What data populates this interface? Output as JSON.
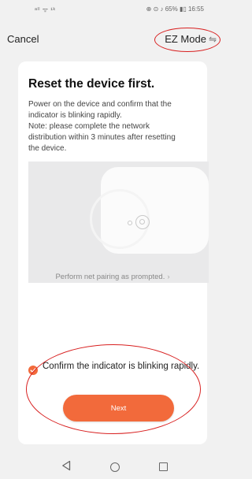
{
  "status_bar": {
    "left": "ᵃˡˡ ᯤ ¹ᵏ",
    "right": "⊕ ⊙ ♪ 65% ▮▯ 16:55"
  },
  "header": {
    "cancel_label": "Cancel",
    "mode_label": "EZ Mode",
    "mode_icon": "swap-icon"
  },
  "card": {
    "title": "Reset the device first.",
    "description_lines": [
      "Power on the device and confirm that the",
      "indicator is blinking rapidly.",
      "Note: please complete the network",
      "distribution within 3 minutes after resetting",
      "the device."
    ],
    "prompt_link": "Perform net pairing as prompted.",
    "confirm_label": "Confirm the indicator is blinking rapidly.",
    "confirm_checked": true,
    "next_label": "Next"
  },
  "colors": {
    "accent": "#f26a3b",
    "annotation": "#d82020"
  },
  "nav_bar": {
    "icons": [
      "back-triangle-icon",
      "home-circle-icon",
      "recents-square-icon"
    ]
  }
}
